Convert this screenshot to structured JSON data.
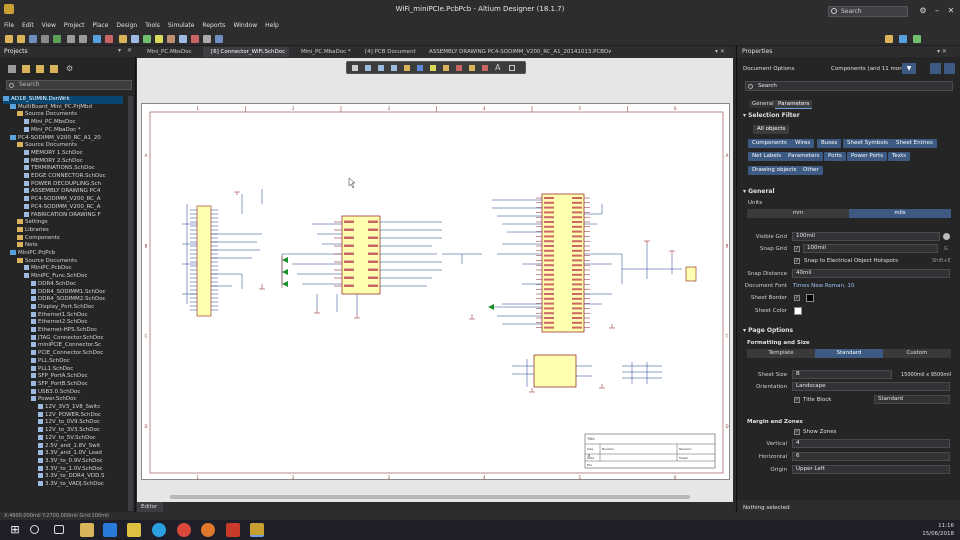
{
  "window": {
    "title": "WiFi_miniPCIe.PcbPcb - Altium Designer (18.1.7)",
    "search": "Search"
  },
  "menu": [
    "File",
    "Edit",
    "View",
    "Project",
    "Place",
    "Design",
    "Tools",
    "Simulate",
    "Reports",
    "Window",
    "Help"
  ],
  "projects_panel": {
    "title": "Projects",
    "search_placeholder": "Search",
    "items": [
      {
        "label": "AD18_SUMIN.DsnWrk",
        "indent": 0,
        "kind": "proj",
        "selected": true
      },
      {
        "label": "MultiBoard_Mini_PC.PrjMbd",
        "indent": 1,
        "kind": "proj"
      },
      {
        "label": "Source Documents",
        "indent": 2,
        "kind": "folder"
      },
      {
        "label": "Mini_PC.MbsDoc",
        "indent": 3,
        "kind": "doc"
      },
      {
        "label": "Mini_PC.MbaDoc *",
        "indent": 3,
        "kind": "doc"
      },
      {
        "label": "PC4-SODIMM_V200_RC_A1_20",
        "indent": 1,
        "kind": "proj"
      },
      {
        "label": "Source Documents",
        "indent": 2,
        "kind": "folder"
      },
      {
        "label": "MEMORY 1.SchDoc",
        "indent": 3,
        "kind": "doc"
      },
      {
        "label": "MEMORY 2.SchDoc",
        "indent": 3,
        "kind": "doc"
      },
      {
        "label": "TERMINATIONS.SchDoc",
        "indent": 3,
        "kind": "doc"
      },
      {
        "label": "EDGE CONNECTOR.SchDoc",
        "indent": 3,
        "kind": "doc"
      },
      {
        "label": "POWER DECOUPLING.Sch",
        "indent": 3,
        "kind": "doc"
      },
      {
        "label": "ASSEMBLY DRAWING PC4",
        "indent": 3,
        "kind": "doc"
      },
      {
        "label": "PC4-SODIMM_V200_RC_A",
        "indent": 3,
        "kind": "doc"
      },
      {
        "label": "PC4-SODIMM_V200_RC_A",
        "indent": 3,
        "kind": "doc"
      },
      {
        "label": "FABRICATION DRAWING F",
        "indent": 3,
        "kind": "doc"
      },
      {
        "label": "Settings",
        "indent": 2,
        "kind": "folder"
      },
      {
        "label": "Libraries",
        "indent": 2,
        "kind": "folder"
      },
      {
        "label": "Components",
        "indent": 2,
        "kind": "folder"
      },
      {
        "label": "Nets",
        "indent": 2,
        "kind": "folder"
      },
      {
        "label": "MiniPC.PrjPcb",
        "indent": 1,
        "kind": "proj"
      },
      {
        "label": "Source Documents",
        "indent": 2,
        "kind": "folder"
      },
      {
        "label": "MiniPC.PcbDoc",
        "indent": 3,
        "kind": "doc"
      },
      {
        "label": "MiniPC_Func.SchDoc",
        "indent": 3,
        "kind": "doc"
      },
      {
        "label": "DDR4.SchDoc",
        "indent": 4,
        "kind": "doc"
      },
      {
        "label": "DDR4_SODIMM1.SchDoc",
        "indent": 4,
        "kind": "doc"
      },
      {
        "label": "DDR4_SODIMM2.SchDoc",
        "indent": 4,
        "kind": "doc"
      },
      {
        "label": "Display_Port.SchDoc",
        "indent": 4,
        "kind": "doc"
      },
      {
        "label": "Ethernet1.SchDoc",
        "indent": 4,
        "kind": "doc"
      },
      {
        "label": "Ethernet2.SchDoc",
        "indent": 4,
        "kind": "doc"
      },
      {
        "label": "Ethernet-HPS.SchDoc",
        "indent": 4,
        "kind": "doc"
      },
      {
        "label": "JTAG_Connector.SchDoc",
        "indent": 4,
        "kind": "doc"
      },
      {
        "label": "miniPCIE_Connector.Sc",
        "indent": 4,
        "kind": "doc"
      },
      {
        "label": "PCIE_Connector.SchDoc",
        "indent": 4,
        "kind": "doc"
      },
      {
        "label": "PLL.SchDoc",
        "indent": 4,
        "kind": "doc"
      },
      {
        "label": "PLL1.SchDoc",
        "indent": 4,
        "kind": "doc"
      },
      {
        "label": "SFP_PortA.SchDoc",
        "indent": 4,
        "kind": "doc"
      },
      {
        "label": "SFP_PortB.SchDoc",
        "indent": 4,
        "kind": "doc"
      },
      {
        "label": "USB3.0.SchDoc",
        "indent": 4,
        "kind": "doc"
      },
      {
        "label": "Power.SchDoc",
        "indent": 4,
        "kind": "doc"
      },
      {
        "label": "12V_3V3_1V8_Switc",
        "indent": 5,
        "kind": "doc"
      },
      {
        "label": "12V_POWER.SchDoc",
        "indent": 5,
        "kind": "doc"
      },
      {
        "label": "12V_to_0V9.SchDoc",
        "indent": 5,
        "kind": "doc"
      },
      {
        "label": "12V_to_3V3.SchDoc",
        "indent": 5,
        "kind": "doc"
      },
      {
        "label": "12V_to_5V.SchDoc",
        "indent": 5,
        "kind": "doc"
      },
      {
        "label": "2.5V_and_1.8V_Swit",
        "indent": 5,
        "kind": "doc"
      },
      {
        "label": "3.3V_and_1.0V_Load",
        "indent": 5,
        "kind": "doc"
      },
      {
        "label": "3.3V_to_0.9V.SchDoc",
        "indent": 5,
        "kind": "doc"
      },
      {
        "label": "3.3V_to_1.0V.SchDoc",
        "indent": 5,
        "kind": "doc"
      },
      {
        "label": "3.3V_to_DDR4_VDD.S",
        "indent": 5,
        "kind": "doc"
      },
      {
        "label": "3.3V_to_VADJ.SchDoc",
        "indent": 5,
        "kind": "doc"
      }
    ]
  },
  "tabs": [
    {
      "label": "Mini_PC.MbsDoc",
      "active": false
    },
    {
      "label": "[6] Connector_WiFi.SchDoc",
      "active": true
    },
    {
      "label": "Mini_PC.MbaDoc *",
      "active": false
    },
    {
      "label": "[4] PCB Document",
      "active": false
    },
    {
      "label": "ASSEMBLY DRAWING PC4-SODIMM_V200_RC_A1_20141013.PCBDwf",
      "active": false
    }
  ],
  "editor_tab": "Editor",
  "schematic": {
    "title_block": {
      "size_label": "Size",
      "size": "B",
      "date_label": "Date",
      "sheet_label": "Sheet",
      "file_label": "File",
      "title_label": "Title",
      "number_label": "Number",
      "revision_label": "Revision"
    },
    "zone_numbers": [
      "1",
      "2",
      "3",
      "4",
      "5",
      "6"
    ],
    "zone_letters": [
      "A",
      "B",
      "C",
      "D"
    ]
  },
  "properties": {
    "title": "Properties",
    "doc_options": "Document Options",
    "filter_summary": "Components (and 11 more)",
    "search_placeholder": "Search",
    "tabs": [
      "General",
      "Parameters"
    ],
    "selection_filter": {
      "header": "Selection Filter",
      "all": "All objects",
      "chips": [
        "Components",
        "Wires",
        "Buses",
        "Sheet Symbols",
        "Sheet Entries",
        "Net Labels",
        "Parameters",
        "Ports",
        "Power Ports",
        "Texts",
        "Drawing objects",
        "Other"
      ]
    },
    "general": {
      "header": "General",
      "units_label": "Units",
      "units": [
        "mm",
        "mils"
      ],
      "units_selected": "mils",
      "visible_grid_label": "Visible Grid",
      "visible_grid": "100mil",
      "snap_grid_label": "Snap Grid",
      "snap_grid": "100mil",
      "snap_grid_key": "G",
      "snap_hotspots": "Snap to Electrical Object Hotspots",
      "snap_hotspots_key": "Shift+E",
      "snap_distance_label": "Snap Distance",
      "snap_distance": "40mil",
      "font_label": "Document Font",
      "font": "Times New Roman, 10",
      "border_label": "Sheet Border",
      "color_label": "Sheet Color"
    },
    "page_options": {
      "header": "Page Options",
      "format_label": "Formatting and Size",
      "formats": [
        "Template",
        "Standard",
        "Custom"
      ],
      "format_selected": "Standard",
      "sheet_size_label": "Sheet Size",
      "sheet_size": "B",
      "sheet_size_dims": "15000mil x 9500mil",
      "orientation_label": "Orientation",
      "orientation": "Landscape",
      "title_block_label": "Title Block",
      "title_block": "Standard",
      "margin_label": "Margin and Zones",
      "show_zones": "Show Zones",
      "vertical_label": "Vertical",
      "vertical": "4",
      "horizontal_label": "Horizontal",
      "horizontal": "6",
      "origin_label": "Origin",
      "origin": "Upper Left"
    },
    "footer": "Nothing selected"
  },
  "status_bar": "X:4900.000mil Y:2700.000mil   Grid:100mil",
  "taskbar": {
    "time": "11:16",
    "date": "15/06/2018"
  },
  "colors": {
    "accent": "#3c5a82",
    "panel": "#252526",
    "chrome": "#2d2d30",
    "wire": "#1f3f8f",
    "part_fill": "#ffffb0",
    "part_border": "#8b1a1a"
  }
}
